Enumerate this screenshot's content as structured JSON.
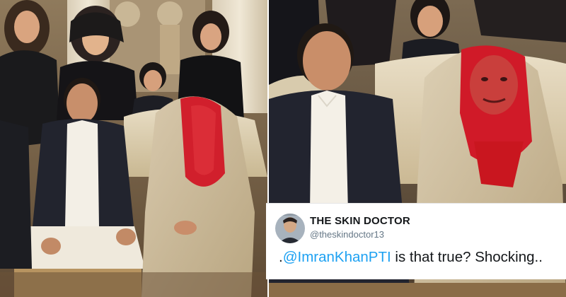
{
  "tweet": {
    "display_name": "THE SKIN DOCTOR",
    "handle": "@theskindoctor13",
    "text_prefix": ".",
    "mention": "@ImranKhanPTI",
    "text_rest": " is that true? Shocking..",
    "mention_color": "#1da1f2",
    "text_color": "#14171a",
    "handle_color": "#657786"
  },
  "images": {
    "left_photo": "wedding-photo-original",
    "right_photo": "wedding-photo-edited"
  }
}
